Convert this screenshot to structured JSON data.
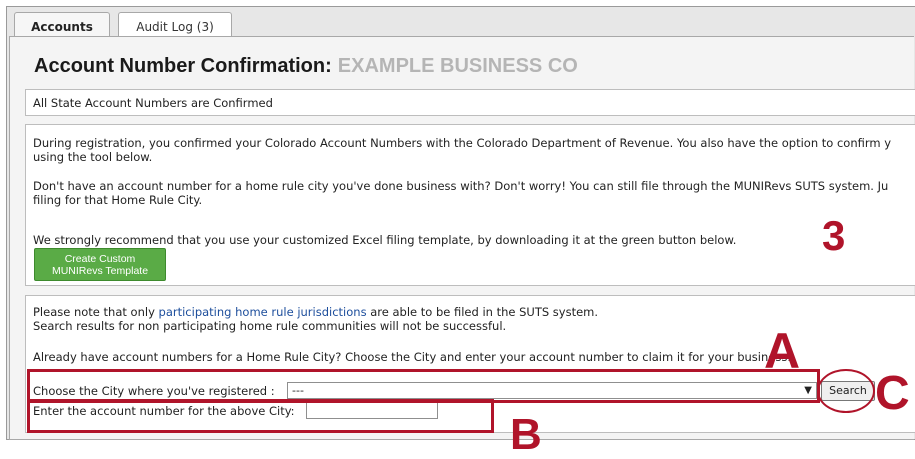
{
  "tabs": {
    "accounts": "Accounts",
    "audit_log": "Audit Log (3)"
  },
  "header": {
    "title": "Account Number Confirmation:",
    "company": "EXAMPLE BUSINESS CO"
  },
  "status": {
    "message": "All State Account Numbers are Confirmed"
  },
  "info": {
    "p1_line1": "During registration, you confirmed your Colorado Account Numbers with the Colorado Department of Revenue. You also have the option to confirm y",
    "p1_line2": "using the tool below.",
    "p2_line1": "Don't have an account number for a home rule city you've done business with? Don't worry! You can still file through the MUNIRevs SUTS system. Ju",
    "p2_line2": "filing for that Home Rule City.",
    "p3": "We strongly recommend that you use your customized Excel filing template, by downloading it at the green button below.",
    "template_button_line1": "Create Custom",
    "template_button_line2": "MUNIRevs Template"
  },
  "claim": {
    "note_prefix": "Please note that only ",
    "note_link": "participating home rule jurisdictions",
    "note_suffix": " are able to be filed in the SUTS system.",
    "note_line2": "Search results for non participating home rule communities will not be successful.",
    "prompt": "Already have account numbers for a Home Rule City? Choose the City and enter your account number to claim it for your business.",
    "city_label": "Choose the City where you've registered :",
    "city_selected": "---",
    "search_label": "Search",
    "account_label": "Enter the account number for the above City:",
    "account_value": ""
  },
  "annotations": {
    "a": "A",
    "b": "B",
    "c": "C",
    "three": "3",
    "color": "#b0142a"
  },
  "colors": {
    "accent_green": "#5aab46",
    "link": "#1d4e9c"
  }
}
